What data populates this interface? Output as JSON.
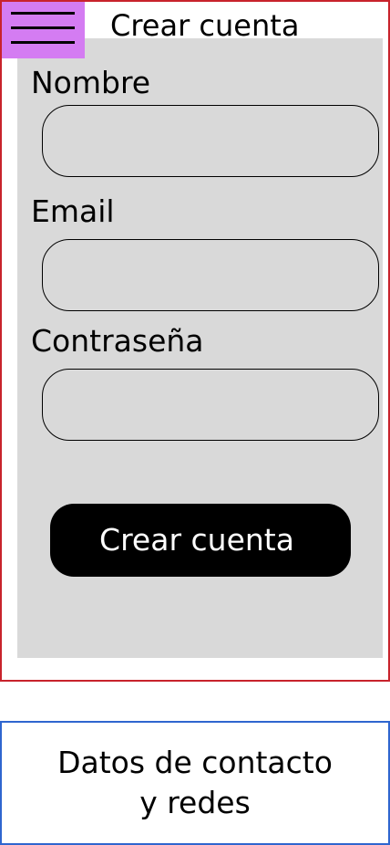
{
  "header": {
    "menu_icon": "hamburger-menu-icon",
    "title": "Crear cuenta",
    "menu_color": "#d47cf2"
  },
  "form": {
    "fields": [
      {
        "label": "Nombre",
        "value": "",
        "placeholder": ""
      },
      {
        "label": "Email",
        "value": "",
        "placeholder": ""
      },
      {
        "label": "Contraseña",
        "value": "",
        "placeholder": ""
      }
    ],
    "submit_label": "Crear cuenta",
    "panel_color": "#d9d9d9"
  },
  "footer": {
    "contact_text": "Datos de contacto\ny redes"
  },
  "colors": {
    "main_frame_border": "#c8232c",
    "footer_border": "#2f66cf",
    "button_bg": "#000000",
    "button_text": "#ffffff"
  }
}
